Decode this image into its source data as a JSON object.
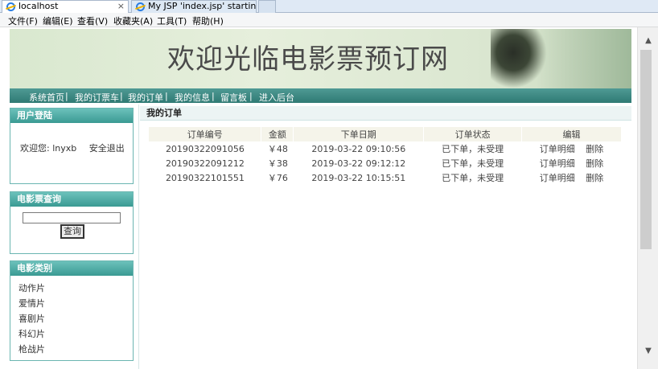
{
  "browser": {
    "tabs": [
      {
        "label": "localhost"
      },
      {
        "label": "My JSP 'index.jsp' starting ..."
      }
    ],
    "tab_close": "×",
    "menu": [
      "文件(F)",
      "编辑(E)",
      "查看(V)",
      "收藏夹(A)",
      "工具(T)",
      "帮助(H)"
    ],
    "scroll_up": "▲",
    "scroll_down": "▼"
  },
  "banner": {
    "title": "欢迎光临电影票预订网"
  },
  "nav": [
    "系统首页",
    "我的订票车",
    "我的订单",
    "我的信息",
    "留言板",
    "进入后台"
  ],
  "nav_separator": "|",
  "login_panel": {
    "title": "用户登陆",
    "welcome_prefix": "欢迎您:",
    "username": "lnyxb",
    "logout": "安全退出"
  },
  "search_panel": {
    "title": "电影票查询",
    "input_value": "",
    "button": "查询"
  },
  "category_panel": {
    "title": "电影类别",
    "items": [
      "动作片",
      "爱情片",
      "喜剧片",
      "科幻片",
      "枪战片"
    ]
  },
  "orders_panel": {
    "title": "我的订单",
    "columns": [
      "订单编号",
      "金额",
      "下单日期",
      "订单状态",
      "编辑"
    ],
    "actions": {
      "detail": "订单明细",
      "delete": "删除"
    },
    "rows": [
      {
        "id": "20190322091056",
        "amount": "￥48",
        "date": "2019-03-22 09:10:56",
        "status": "已下单，未受理"
      },
      {
        "id": "20190322091212",
        "amount": "￥38",
        "date": "2019-03-22 09:12:12",
        "status": "已下单，未受理"
      },
      {
        "id": "20190322101551",
        "amount": "￥76",
        "date": "2019-03-22 10:15:51",
        "status": "已下单，未受理"
      }
    ]
  }
}
